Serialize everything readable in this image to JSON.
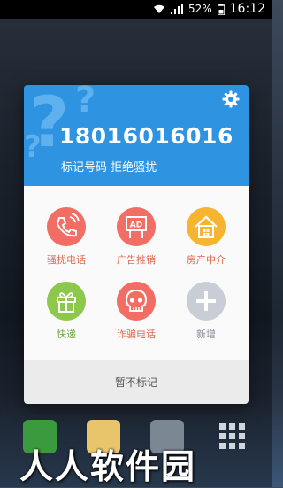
{
  "statusbar": {
    "battery": "52%",
    "time": "16:12"
  },
  "dialog": {
    "phone_number": "18016016016",
    "subtitle": "标记号码  拒绝骚扰",
    "categories": [
      {
        "label": "骚扰电话",
        "color": "#f26d63",
        "label_color": "#e06a52",
        "icon": "phone-harass-icon"
      },
      {
        "label": "广告推销",
        "color": "#f26d63",
        "label_color": "#e06a52",
        "icon": "ad-sign-icon"
      },
      {
        "label": "房产中介",
        "color": "#f7b431",
        "label_color": "#e06a52",
        "icon": "house-icon"
      },
      {
        "label": "快递",
        "color": "#8cc84b",
        "label_color": "#6aa83a",
        "icon": "gift-icon"
      },
      {
        "label": "诈骗电话",
        "color": "#f26d63",
        "label_color": "#e06a52",
        "icon": "skull-icon"
      },
      {
        "label": "新增",
        "color": "#c9ced6",
        "label_color": "#8a8f97",
        "icon": "plus-icon"
      }
    ],
    "footer_label": "暂不标记"
  },
  "watermark": "人人软件园"
}
